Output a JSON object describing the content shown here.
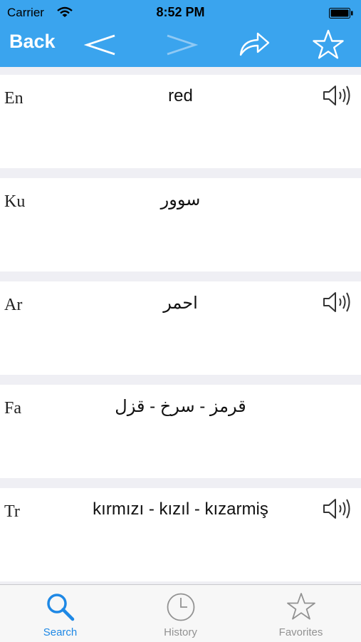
{
  "status_bar": {
    "carrier": "Carrier",
    "time": "8:52 PM"
  },
  "nav": {
    "back_label": "Back",
    "icons": [
      "chevron-left-icon",
      "chevron-right-icon",
      "share-icon",
      "star-icon"
    ]
  },
  "rows": [
    {
      "lang": "En",
      "term": "red",
      "has_audio": true
    },
    {
      "lang": "Ku",
      "term": "سوور",
      "has_audio": false
    },
    {
      "lang": "Ar",
      "term": "احمر",
      "has_audio": true
    },
    {
      "lang": "Fa",
      "term": "قرمز - سرخ - قزل",
      "has_audio": false
    },
    {
      "lang": "Tr",
      "term": "kırmızı - kızıl - kızarmiş",
      "has_audio": true
    }
  ],
  "tabs": [
    {
      "label": "Search",
      "icon": "search-icon",
      "active": true
    },
    {
      "label": "History",
      "icon": "clock-icon",
      "active": false
    },
    {
      "label": "Favorites",
      "icon": "star-icon",
      "active": false
    }
  ],
  "colors": {
    "accent": "#3aa4ee",
    "tab_active": "#1e88e5",
    "tab_inactive": "#929292"
  }
}
